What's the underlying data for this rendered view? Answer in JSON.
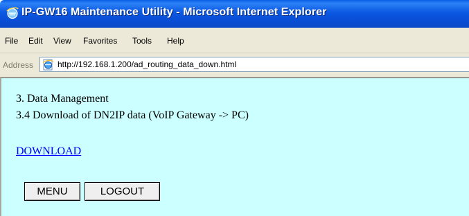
{
  "window": {
    "title": "IP-GW16 Maintenance Utility - Microsoft Internet Explorer"
  },
  "menubar": {
    "items": [
      "File",
      "Edit",
      "View",
      "Favorites",
      "Tools",
      "Help"
    ]
  },
  "addressbar": {
    "label": "Address",
    "url": "http://192.168.1.200/ad_routing_data_down.html",
    "page_icon": "ie-page-icon"
  },
  "content": {
    "background": "#ccffff",
    "heading1": "3. Data Management",
    "heading2": "3.4 Download of DN2IP data (VoIP Gateway -> PC)",
    "download_link": "DOWNLOAD",
    "buttons": {
      "menu": "MENU",
      "logout": "LOGOUT"
    }
  },
  "colors": {
    "titlebar": "#0b58e2",
    "link": "#0000ff",
    "chrome": "#ece9d8"
  }
}
